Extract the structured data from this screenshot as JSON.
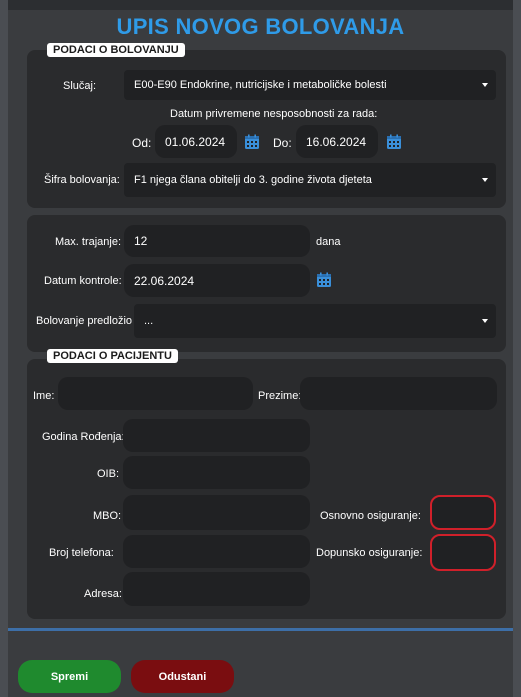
{
  "title": "UPIS NOVOG BOLOVANJA",
  "sick_leave": {
    "legend": "PODACI O BOLOVANJU",
    "case_label": "Slučaj:",
    "case_value": "E00-E90 Endokrine, nutricijske i metaboličke bolesti",
    "date_range_caption": "Datum privremene nesposobnosti za rada:",
    "from_label": "Od:",
    "from_value": "01.06.2024",
    "to_label": "Do:",
    "to_value": "16.06.2024",
    "code_label": "Šifra bolovanja:",
    "code_value": "F1 njega člana obitelji do 3. godine života djeteta"
  },
  "duration": {
    "max_label": "Max. trajanje:",
    "max_value": "12",
    "max_unit": "dana",
    "control_label": "Datum kontrole:",
    "control_value": "22.06.2024",
    "proposed_label": "Bolovanje predložio",
    "proposed_value": "..."
  },
  "patient": {
    "legend": "PODACI O PACIJENTU",
    "first_name_label": "Ime:",
    "first_name_value": "",
    "last_name_label": "Prezime:",
    "last_name_value": "",
    "birth_year_label": "Godina Rođenja:",
    "birth_year_value": "",
    "oib_label": "OIB:",
    "oib_value": "",
    "mbo_label": "MBO:",
    "mbo_value": "",
    "basic_insurance_label": "Osnovno osiguranje:",
    "phone_label": "Broj telefona:",
    "phone_value": "",
    "supplementary_insurance_label": "Dopunsko osiguranje:",
    "address_label": "Adresa:",
    "address_value": ""
  },
  "buttons": {
    "save": "Spremi",
    "cancel": "Odustani"
  },
  "colors": {
    "title": "#2f9be8",
    "calendar_icon": "#3a8fd9",
    "save_button": "#1f8a2e",
    "cancel_button": "#7a0d10",
    "invalid_border": "#d0202a"
  },
  "icons": [
    "calendar-icon",
    "chevron-down-icon"
  ]
}
